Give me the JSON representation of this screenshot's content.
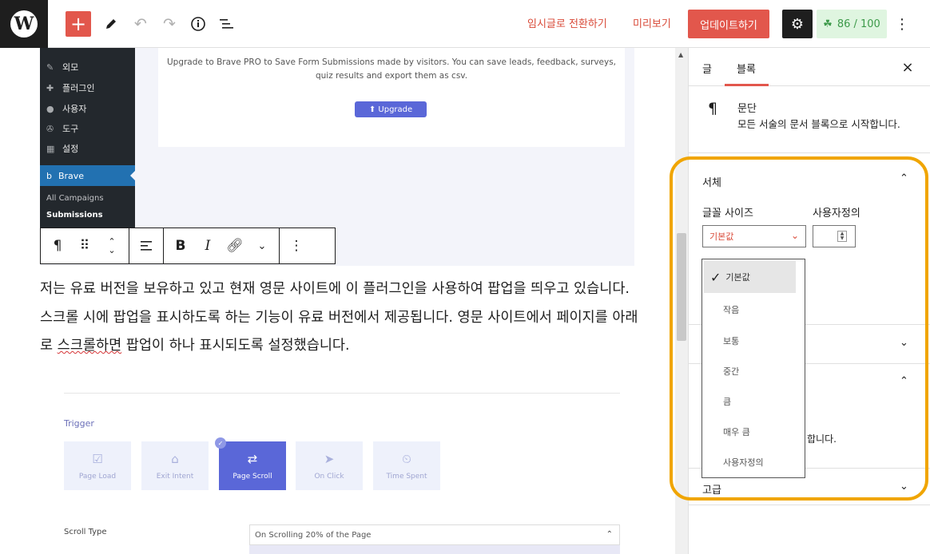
{
  "topbar": {
    "logo": "W",
    "add": "+",
    "switch_to_draft": "임시글로 전환하기",
    "preview": "미리보기",
    "update": "업데이트하기",
    "score": "86 / 100"
  },
  "colors": {
    "accent": "#e2574c",
    "highlight": "#f0a500",
    "admin_bg": "#23282d",
    "admin_active": "#2271b1"
  },
  "admin_menu": {
    "items": [
      "외모",
      "플러그인",
      "사용자",
      "도구",
      "설정"
    ],
    "brave": "Brave",
    "sub_items": [
      "All Campaigns",
      "Submissions"
    ]
  },
  "upgrade_card": {
    "text": "Upgrade to Brave PRO to Save Form Submissions made by visitors. You can save leads, feedback, surveys, quiz results and export them as csv.",
    "button": "⬆ Upgrade"
  },
  "paragraph": {
    "before": "저는 유료 버전을 보유하고 있고 현재 영문 사이트에 이 플러그인을 사용하여 팝업을 띄우고 있습니다. 스크롤 시에 팝업을 표시하도록 하는 기능이 유료 버전에서 제공됩니다. 영문 사이트에서 페이지를 아래로 ",
    "underlined": "스크롤하면",
    "after": " 팝업이 하나 표시되도록 설정했습니다."
  },
  "trigger": {
    "label": "Trigger",
    "options": [
      "Page Load",
      "Exit Intent",
      "Page Scroll",
      "On Click",
      "Time Spent"
    ],
    "active": "Page Scroll",
    "scroll_type_label": "Scroll Type",
    "scroll_type_value": "On Scrolling 20% of the Page"
  },
  "sidebar": {
    "tabs": [
      "글",
      "블록"
    ],
    "active_tab": "블록",
    "block_title": "문단",
    "block_desc": "모든 서술의 문서 블록으로 시작합니다.",
    "typography_title": "서체",
    "font_size_label": "글꼴 사이즈",
    "custom_label": "사용자정의",
    "font_size_value": "기본값",
    "hidden_partial_text": "합니다.",
    "advanced_title": "고급"
  },
  "font_size_dropdown": {
    "options": [
      "기본값",
      "작음",
      "보통",
      "중간",
      "큼",
      "매우 큼",
      "사용자정의"
    ],
    "selected": "기본값"
  }
}
